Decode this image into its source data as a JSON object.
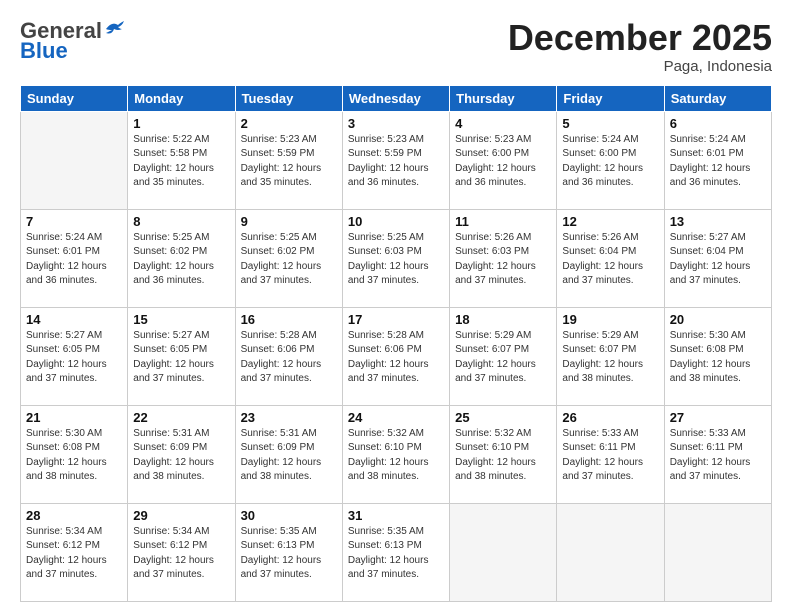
{
  "header": {
    "logo_general": "General",
    "logo_blue": "Blue",
    "month": "December 2025",
    "location": "Paga, Indonesia"
  },
  "weekdays": [
    "Sunday",
    "Monday",
    "Tuesday",
    "Wednesday",
    "Thursday",
    "Friday",
    "Saturday"
  ],
  "weeks": [
    [
      {
        "day": "",
        "text": ""
      },
      {
        "day": "1",
        "text": "Sunrise: 5:22 AM\nSunset: 5:58 PM\nDaylight: 12 hours\nand 35 minutes."
      },
      {
        "day": "2",
        "text": "Sunrise: 5:23 AM\nSunset: 5:59 PM\nDaylight: 12 hours\nand 35 minutes."
      },
      {
        "day": "3",
        "text": "Sunrise: 5:23 AM\nSunset: 5:59 PM\nDaylight: 12 hours\nand 36 minutes."
      },
      {
        "day": "4",
        "text": "Sunrise: 5:23 AM\nSunset: 6:00 PM\nDaylight: 12 hours\nand 36 minutes."
      },
      {
        "day": "5",
        "text": "Sunrise: 5:24 AM\nSunset: 6:00 PM\nDaylight: 12 hours\nand 36 minutes."
      },
      {
        "day": "6",
        "text": "Sunrise: 5:24 AM\nSunset: 6:01 PM\nDaylight: 12 hours\nand 36 minutes."
      }
    ],
    [
      {
        "day": "7",
        "text": "Sunrise: 5:24 AM\nSunset: 6:01 PM\nDaylight: 12 hours\nand 36 minutes."
      },
      {
        "day": "8",
        "text": "Sunrise: 5:25 AM\nSunset: 6:02 PM\nDaylight: 12 hours\nand 36 minutes."
      },
      {
        "day": "9",
        "text": "Sunrise: 5:25 AM\nSunset: 6:02 PM\nDaylight: 12 hours\nand 37 minutes."
      },
      {
        "day": "10",
        "text": "Sunrise: 5:25 AM\nSunset: 6:03 PM\nDaylight: 12 hours\nand 37 minutes."
      },
      {
        "day": "11",
        "text": "Sunrise: 5:26 AM\nSunset: 6:03 PM\nDaylight: 12 hours\nand 37 minutes."
      },
      {
        "day": "12",
        "text": "Sunrise: 5:26 AM\nSunset: 6:04 PM\nDaylight: 12 hours\nand 37 minutes."
      },
      {
        "day": "13",
        "text": "Sunrise: 5:27 AM\nSunset: 6:04 PM\nDaylight: 12 hours\nand 37 minutes."
      }
    ],
    [
      {
        "day": "14",
        "text": "Sunrise: 5:27 AM\nSunset: 6:05 PM\nDaylight: 12 hours\nand 37 minutes."
      },
      {
        "day": "15",
        "text": "Sunrise: 5:27 AM\nSunset: 6:05 PM\nDaylight: 12 hours\nand 37 minutes."
      },
      {
        "day": "16",
        "text": "Sunrise: 5:28 AM\nSunset: 6:06 PM\nDaylight: 12 hours\nand 37 minutes."
      },
      {
        "day": "17",
        "text": "Sunrise: 5:28 AM\nSunset: 6:06 PM\nDaylight: 12 hours\nand 37 minutes."
      },
      {
        "day": "18",
        "text": "Sunrise: 5:29 AM\nSunset: 6:07 PM\nDaylight: 12 hours\nand 37 minutes."
      },
      {
        "day": "19",
        "text": "Sunrise: 5:29 AM\nSunset: 6:07 PM\nDaylight: 12 hours\nand 38 minutes."
      },
      {
        "day": "20",
        "text": "Sunrise: 5:30 AM\nSunset: 6:08 PM\nDaylight: 12 hours\nand 38 minutes."
      }
    ],
    [
      {
        "day": "21",
        "text": "Sunrise: 5:30 AM\nSunset: 6:08 PM\nDaylight: 12 hours\nand 38 minutes."
      },
      {
        "day": "22",
        "text": "Sunrise: 5:31 AM\nSunset: 6:09 PM\nDaylight: 12 hours\nand 38 minutes."
      },
      {
        "day": "23",
        "text": "Sunrise: 5:31 AM\nSunset: 6:09 PM\nDaylight: 12 hours\nand 38 minutes."
      },
      {
        "day": "24",
        "text": "Sunrise: 5:32 AM\nSunset: 6:10 PM\nDaylight: 12 hours\nand 38 minutes."
      },
      {
        "day": "25",
        "text": "Sunrise: 5:32 AM\nSunset: 6:10 PM\nDaylight: 12 hours\nand 38 minutes."
      },
      {
        "day": "26",
        "text": "Sunrise: 5:33 AM\nSunset: 6:11 PM\nDaylight: 12 hours\nand 37 minutes."
      },
      {
        "day": "27",
        "text": "Sunrise: 5:33 AM\nSunset: 6:11 PM\nDaylight: 12 hours\nand 37 minutes."
      }
    ],
    [
      {
        "day": "28",
        "text": "Sunrise: 5:34 AM\nSunset: 6:12 PM\nDaylight: 12 hours\nand 37 minutes."
      },
      {
        "day": "29",
        "text": "Sunrise: 5:34 AM\nSunset: 6:12 PM\nDaylight: 12 hours\nand 37 minutes."
      },
      {
        "day": "30",
        "text": "Sunrise: 5:35 AM\nSunset: 6:13 PM\nDaylight: 12 hours\nand 37 minutes."
      },
      {
        "day": "31",
        "text": "Sunrise: 5:35 AM\nSunset: 6:13 PM\nDaylight: 12 hours\nand 37 minutes."
      },
      {
        "day": "",
        "text": ""
      },
      {
        "day": "",
        "text": ""
      },
      {
        "day": "",
        "text": ""
      }
    ]
  ]
}
